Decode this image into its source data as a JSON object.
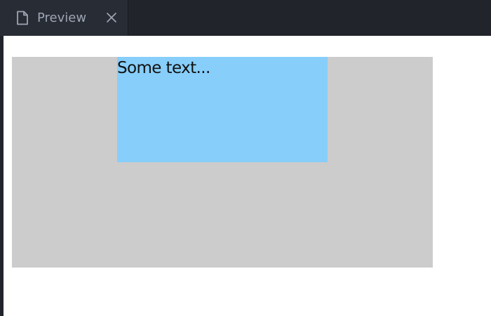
{
  "tab": {
    "label": "Preview",
    "icon": "file-icon",
    "close_icon": "close-icon"
  },
  "preview": {
    "box_text": "Some text..."
  },
  "colors": {
    "tab_background": "#282c34",
    "tab_strip_background": "#21252b",
    "preview_background": "#ffffff",
    "outer_box": "#cccccc",
    "inner_box": "#87cefa",
    "text": "#111111"
  }
}
